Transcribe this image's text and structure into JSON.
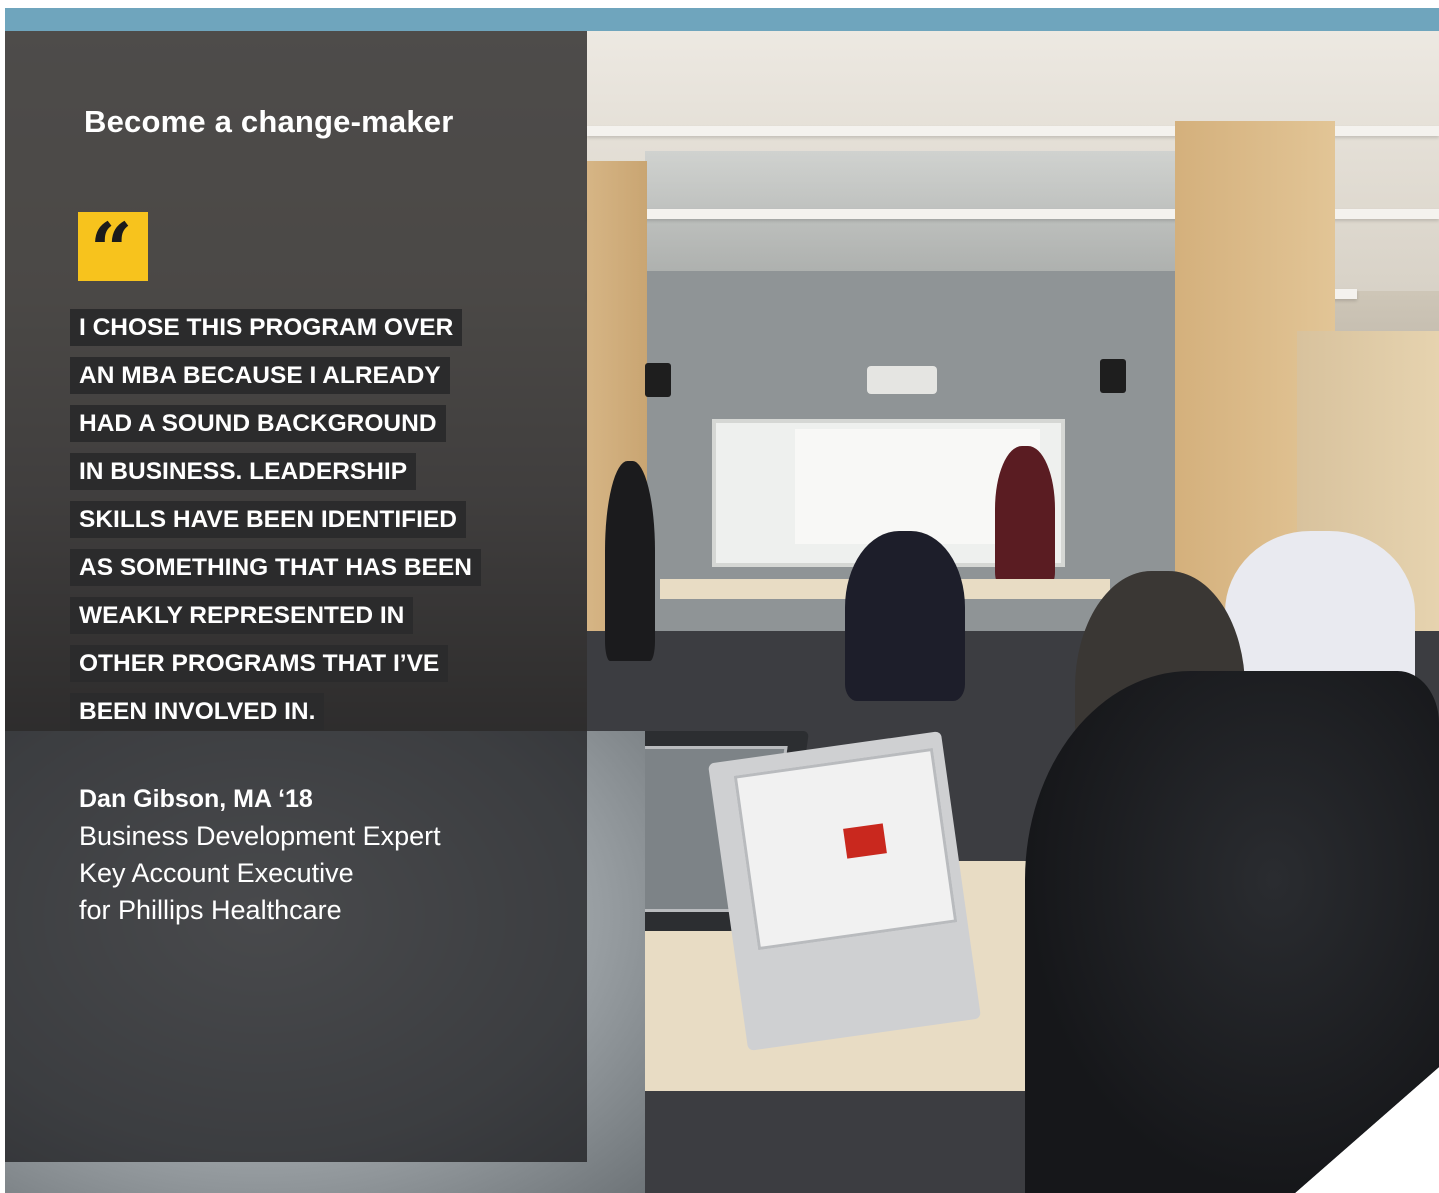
{
  "banner": {
    "heading": "Become a change-maker"
  },
  "quote_icon": "quotation-mark-icon",
  "quote": {
    "lines": [
      "I CHOSE THIS PROGRAM OVER",
      "AN MBA BECAUSE I ALREADY",
      "HAD A SOUND BACKGROUND",
      "IN BUSINESS. LEADERSHIP",
      "SKILLS HAVE BEEN IDENTIFIED",
      "AS SOMETHING THAT HAS BEEN",
      "WEAKLY REPRESENTED IN",
      "OTHER PROGRAMS THAT I’VE",
      "BEEN INVOLVED IN."
    ]
  },
  "attribution": {
    "name": "Dan Gibson, MA ‘18",
    "title_lines": [
      "Business Development Expert",
      "Key Account Executive",
      "for Phillips Healthcare"
    ]
  },
  "colors": {
    "accent_yellow": "#f7c31d",
    "top_band": "#6fa5bd",
    "panel": "#18181b"
  }
}
